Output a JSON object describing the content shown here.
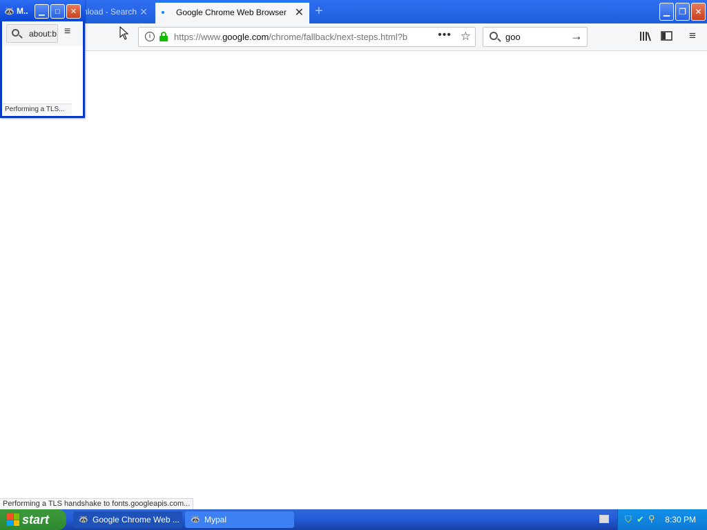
{
  "browser": {
    "tabs": [
      {
        "title": "nload - Search",
        "active": false
      },
      {
        "title": "Google Chrome Web Browser",
        "active": true
      }
    ],
    "url_prefix": "https://www.",
    "url_domain": "google.com",
    "url_path": "/chrome/fallback/next-steps.html?b",
    "search_value": "goo",
    "status_text": "Performing a TLS handshake to fonts.googleapis.com..."
  },
  "mini_window": {
    "title": "M..",
    "address_value": "about:b",
    "status_text": "Performing a TLS..."
  },
  "taskbar": {
    "start_label": "start",
    "tasks": [
      {
        "label": "Google Chrome Web ..."
      },
      {
        "label": "Mypal"
      }
    ],
    "clock": "8:30 PM"
  },
  "icons": {
    "info": "i",
    "more": "•••",
    "star": "☆",
    "go": "→",
    "library": "library-icon",
    "sidebar": "sidebar-icon",
    "menu": "≡"
  }
}
